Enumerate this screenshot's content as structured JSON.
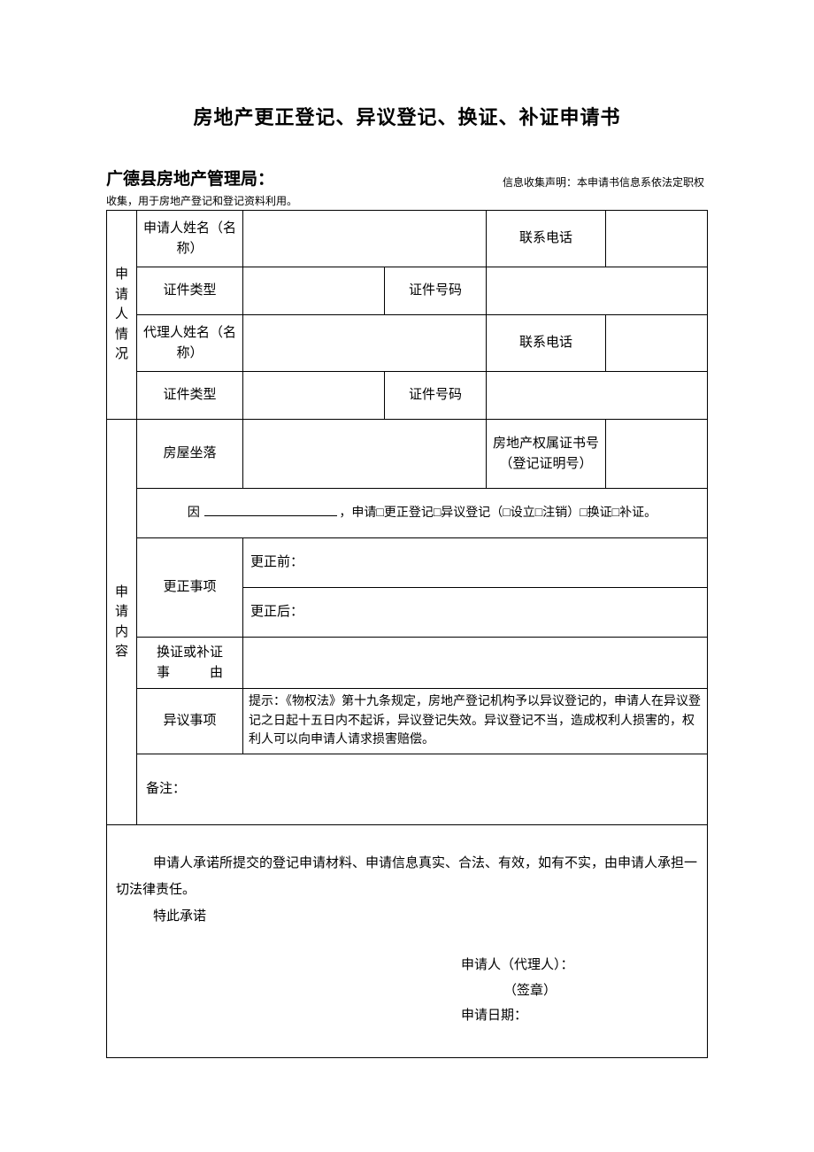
{
  "title": "房地产更正登记、异议登记、换证、补证申请书",
  "agency": "广德县房地产管理局：",
  "notice_right": "信息收集声明：本申请书信息系依法定职权",
  "notice_below": "收集，用于房地产登记和登记资料利用。",
  "section1_label": "申请人情况",
  "row1": {
    "applicant_name_label": "申请人姓名（名称）",
    "phone_label": "联系电话"
  },
  "row2": {
    "id_type_label": "证件类型",
    "id_no_label": "证件号码"
  },
  "row3": {
    "agent_name_label": "代理人姓名（名称）",
    "phone_label": "联系电话"
  },
  "row4": {
    "id_type_label": "证件类型",
    "id_no_label": "证件号码"
  },
  "section2_label": "申请内容",
  "row5": {
    "location_label": "房屋坐落",
    "cert_no_label": "房地产权属证书号（登记证明号）"
  },
  "reason": {
    "prefix": "因",
    "suffix": "，申请□更正登记□异议登记（□设立□注销）□换证□补证。"
  },
  "correction": {
    "label": "更正事项",
    "before": "更正前：",
    "after": "更正后："
  },
  "replace": {
    "label": "换证或补证事由",
    "label_line1": "换证或补证",
    "label_line2": "事　　　由"
  },
  "objection": {
    "label": "异议事项",
    "tip": "提示：《物权法》第十九条规定，房地产登记机构予以异议登记的，申请人在异议登记之日起十五日内不起诉，异议登记失效。异议登记不当，造成权利人损害的，权利人可以向申请人请求损害赔偿。"
  },
  "remarks_label": "备注：",
  "commitment": {
    "line1": "申请人承诺所提交的登记申请材料、申请信息真实、合法、有效，如有不实，由申请人承担一切法律责任。",
    "line2": "特此承诺",
    "sign_label": "申请人（代理人）：",
    "seal_label": "（签章）",
    "date_label": "申请日期："
  }
}
